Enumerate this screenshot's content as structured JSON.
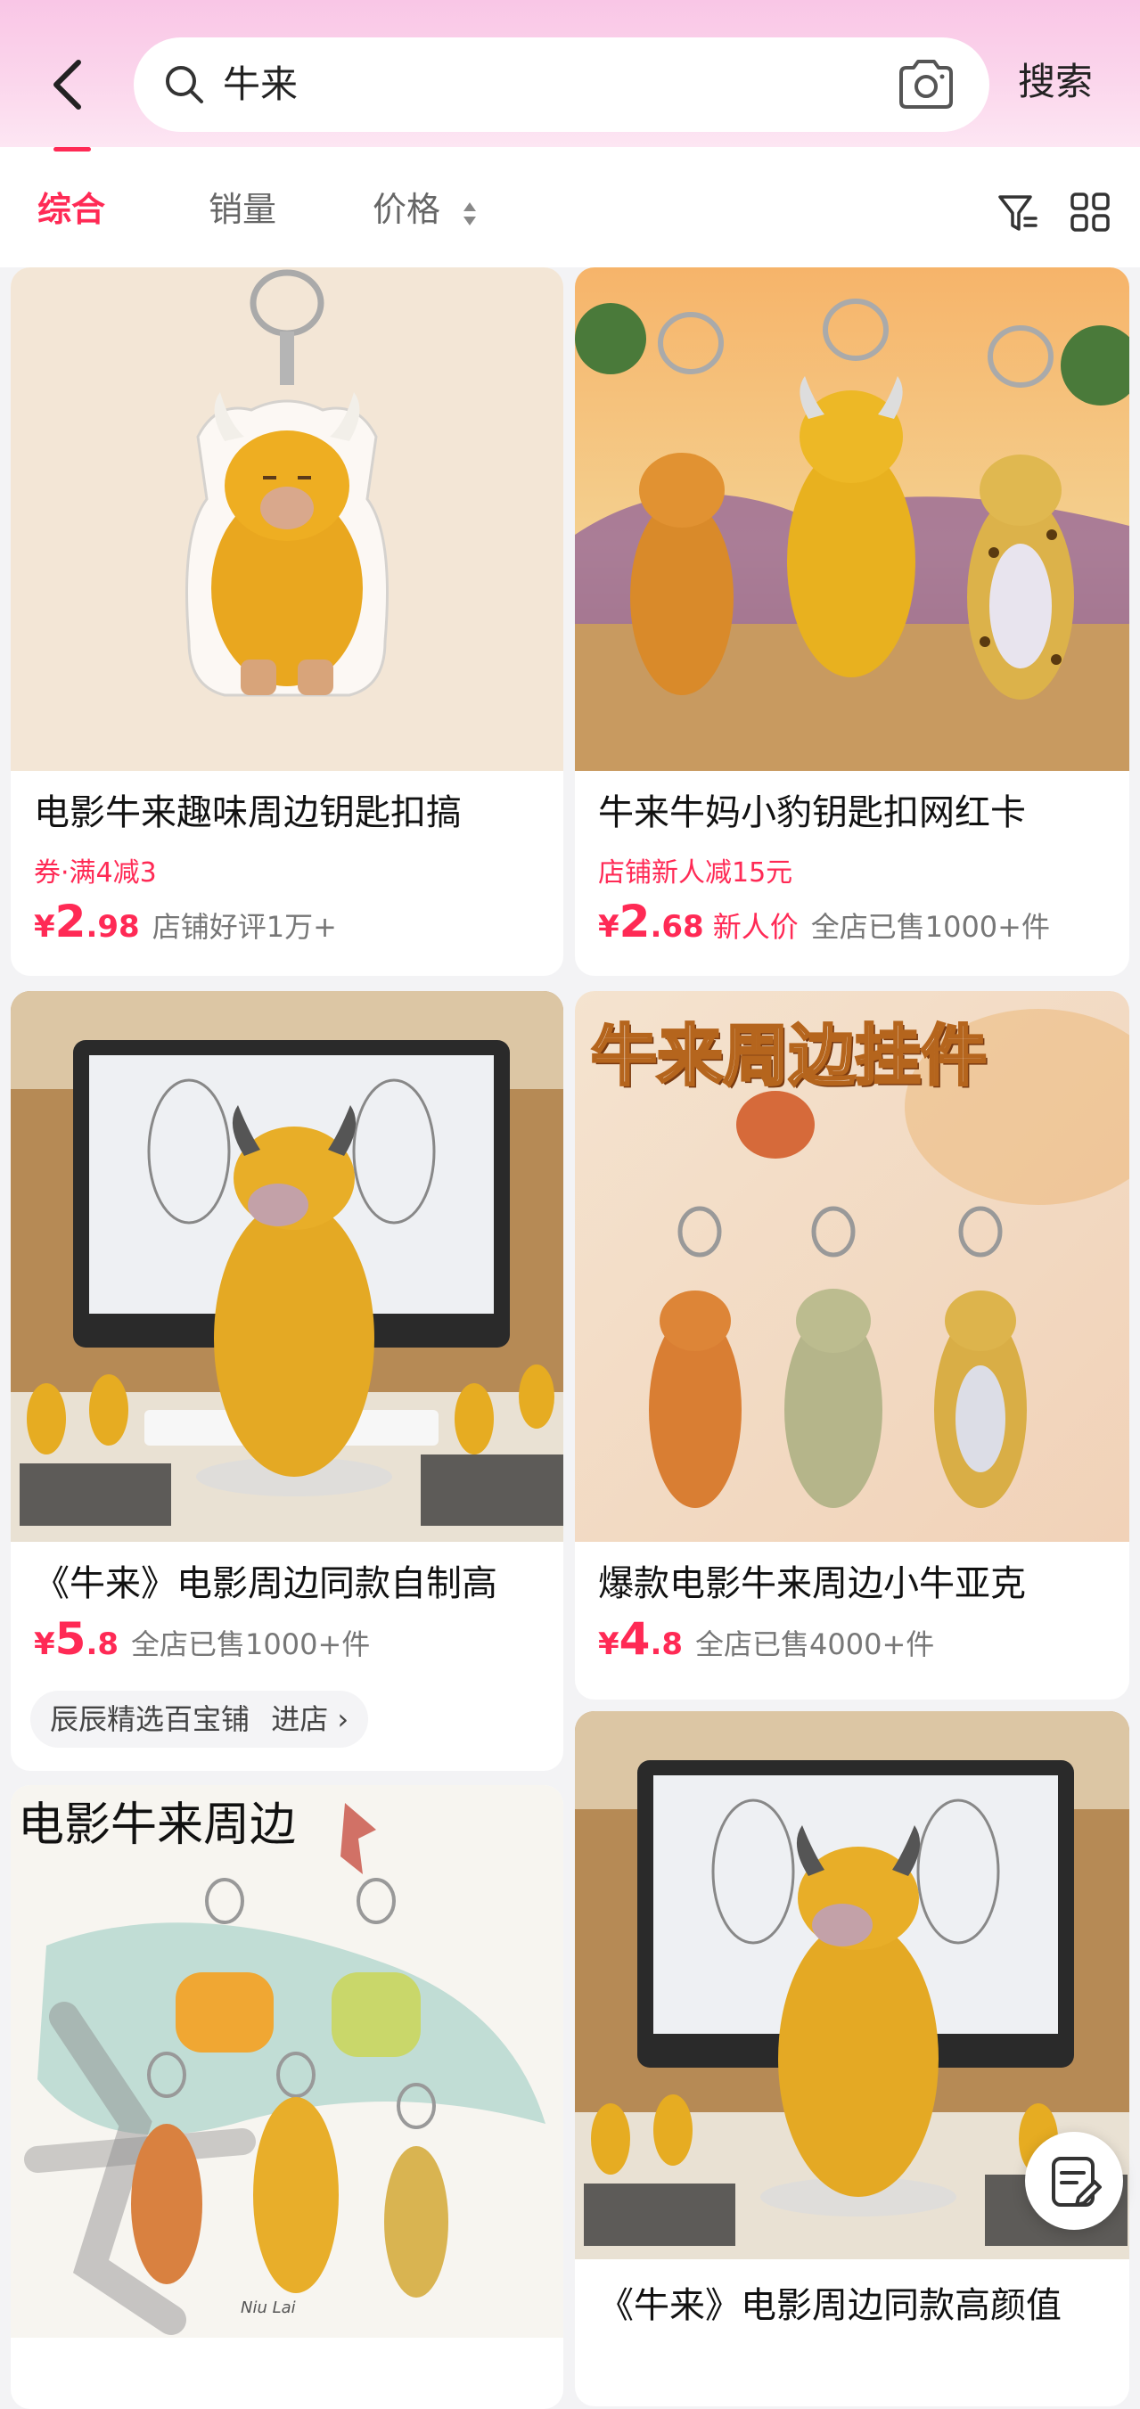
{
  "search": {
    "query": "牛来",
    "button_label": "搜索"
  },
  "sort_tabs": [
    {
      "label": "综合",
      "active": true
    },
    {
      "label": "销量",
      "active": false
    },
    {
      "label": "价格",
      "active": false
    }
  ],
  "colors": {
    "accent": "#ff2a55",
    "header_gradient_top": "#f9c6e6"
  },
  "products": [
    {
      "title": "电影牛来趣味周边钥匙扣搞",
      "promo": "券·满4减3",
      "price_currency": "¥",
      "price_int": "2",
      "price_dec": ".98",
      "meta": "店铺好评1万+"
    },
    {
      "title": "牛来牛妈小豹钥匙扣网红卡",
      "promo": "店铺新人减15元",
      "price_currency": "¥",
      "price_int": "2",
      "price_dec": ".68",
      "new_tag": "新人价",
      "meta": "全店已售1000+件"
    },
    {
      "title": "《牛来》电影周边同款自制高",
      "price_currency": "¥",
      "price_int": "5",
      "price_dec": ".8",
      "meta": "全店已售1000+件",
      "shop_name": "辰辰精选百宝铺",
      "shop_link": "进店 ›"
    },
    {
      "title": "爆款电影牛来周边小牛亚克",
      "image_text": "牛来周边挂件",
      "price_currency": "¥",
      "price_int": "4",
      "price_dec": ".8",
      "meta": "全店已售4000+件"
    },
    {
      "image_text": "电影牛来周边",
      "image_text_small": "Niu Lai"
    },
    {
      "title": "《牛来》电影周边同款高颜值"
    }
  ]
}
